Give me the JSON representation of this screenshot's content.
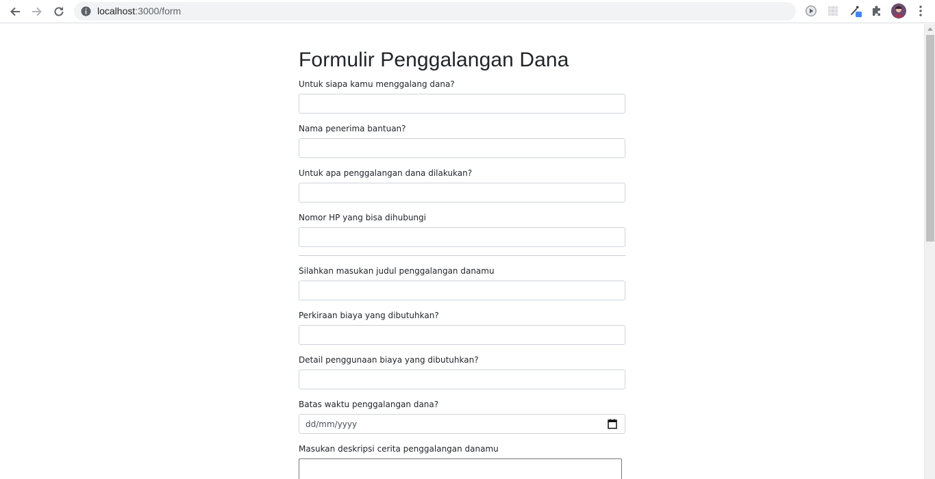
{
  "browser": {
    "url_host": "localhost",
    "url_path": ":3000/form"
  },
  "form": {
    "title": "Formulir Penggalangan Dana",
    "fields": [
      {
        "label": "Untuk siapa kamu menggalang dana?",
        "value": ""
      },
      {
        "label": "Nama penerima bantuan?",
        "value": ""
      },
      {
        "label": "Untuk apa penggalangan dana dilakukan?",
        "value": ""
      },
      {
        "label": "Nomor HP yang bisa dihubungi",
        "value": ""
      },
      {
        "label": "Silahkan masukan judul penggalangan danamu",
        "value": ""
      },
      {
        "label": "Perkiraan biaya yang dibutuhkan?",
        "value": ""
      },
      {
        "label": "Detail penggunaan biaya yang dibutuhkan?",
        "value": ""
      },
      {
        "label": "Batas waktu penggalangan dana?",
        "value": "dd/mm/yyyy"
      },
      {
        "label": "Masukan deskripsi cerita penggalangan danamu",
        "value": ""
      }
    ]
  },
  "colors": {
    "input_border": "#ced4da",
    "text": "#212529",
    "toolbar_bg": "#ffffff",
    "omnibox_bg": "#f1f3f4"
  }
}
